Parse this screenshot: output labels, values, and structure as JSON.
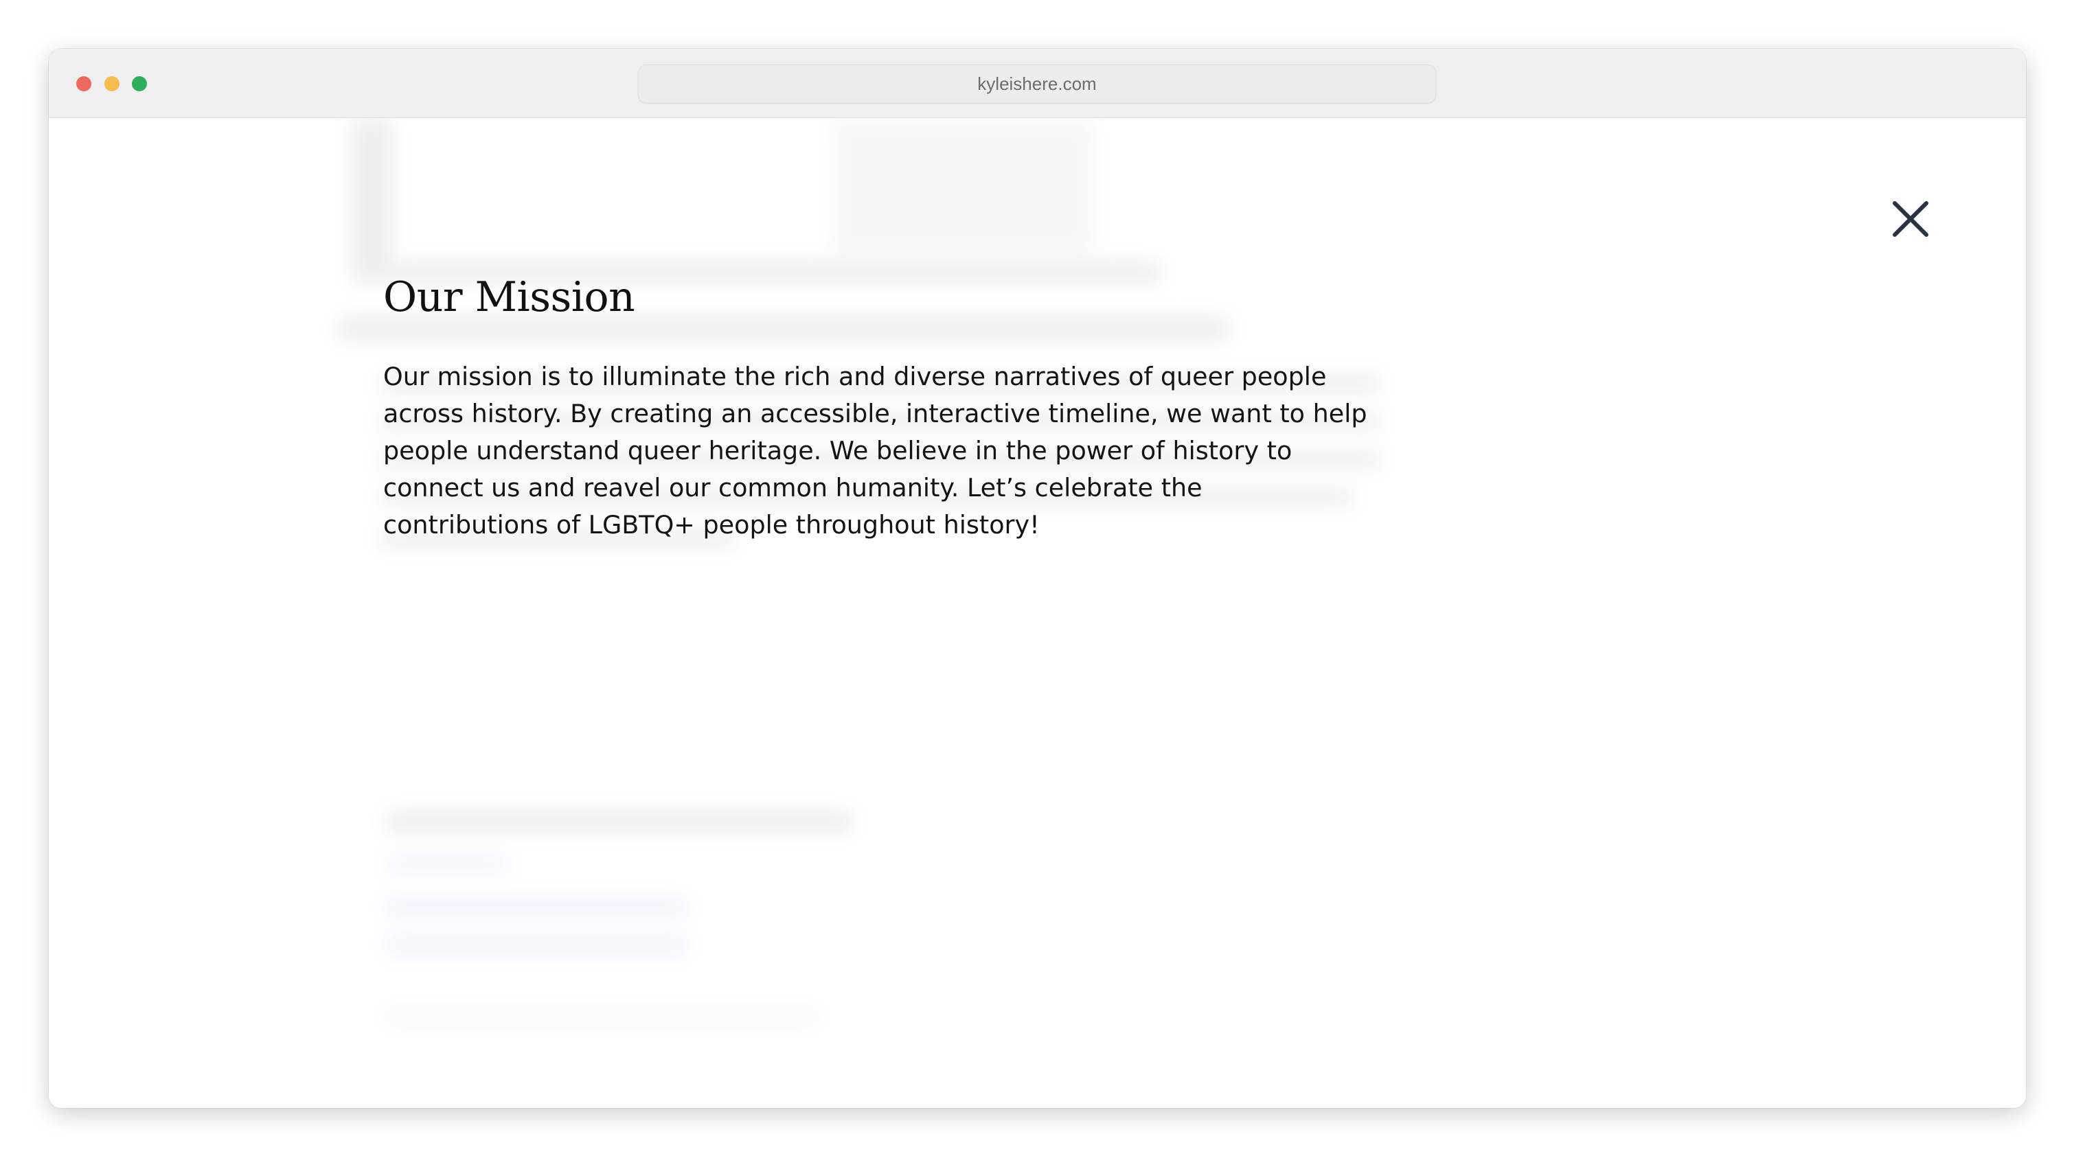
{
  "browser": {
    "url": "kyleishere.com"
  },
  "modal": {
    "title": "Our Mission",
    "body": "Our mission is to illuminate the rich and diverse narratives of queer people across history. By creating an accessible, interactive timeline, we want to help people understand queer heritage. We believe in the power of history to connect us and reavel our common humanity. Let’s celebrate the contributions of LGBTQ+ people throughout history!",
    "close_icon": "close-icon"
  },
  "colors": {
    "title_bar": "#efefef",
    "close_icon": "#2a3140",
    "text": "#141414",
    "traffic_close": "#ee6a5f",
    "traffic_minimize": "#f5bd4f",
    "traffic_zoom": "#2fae5d"
  }
}
